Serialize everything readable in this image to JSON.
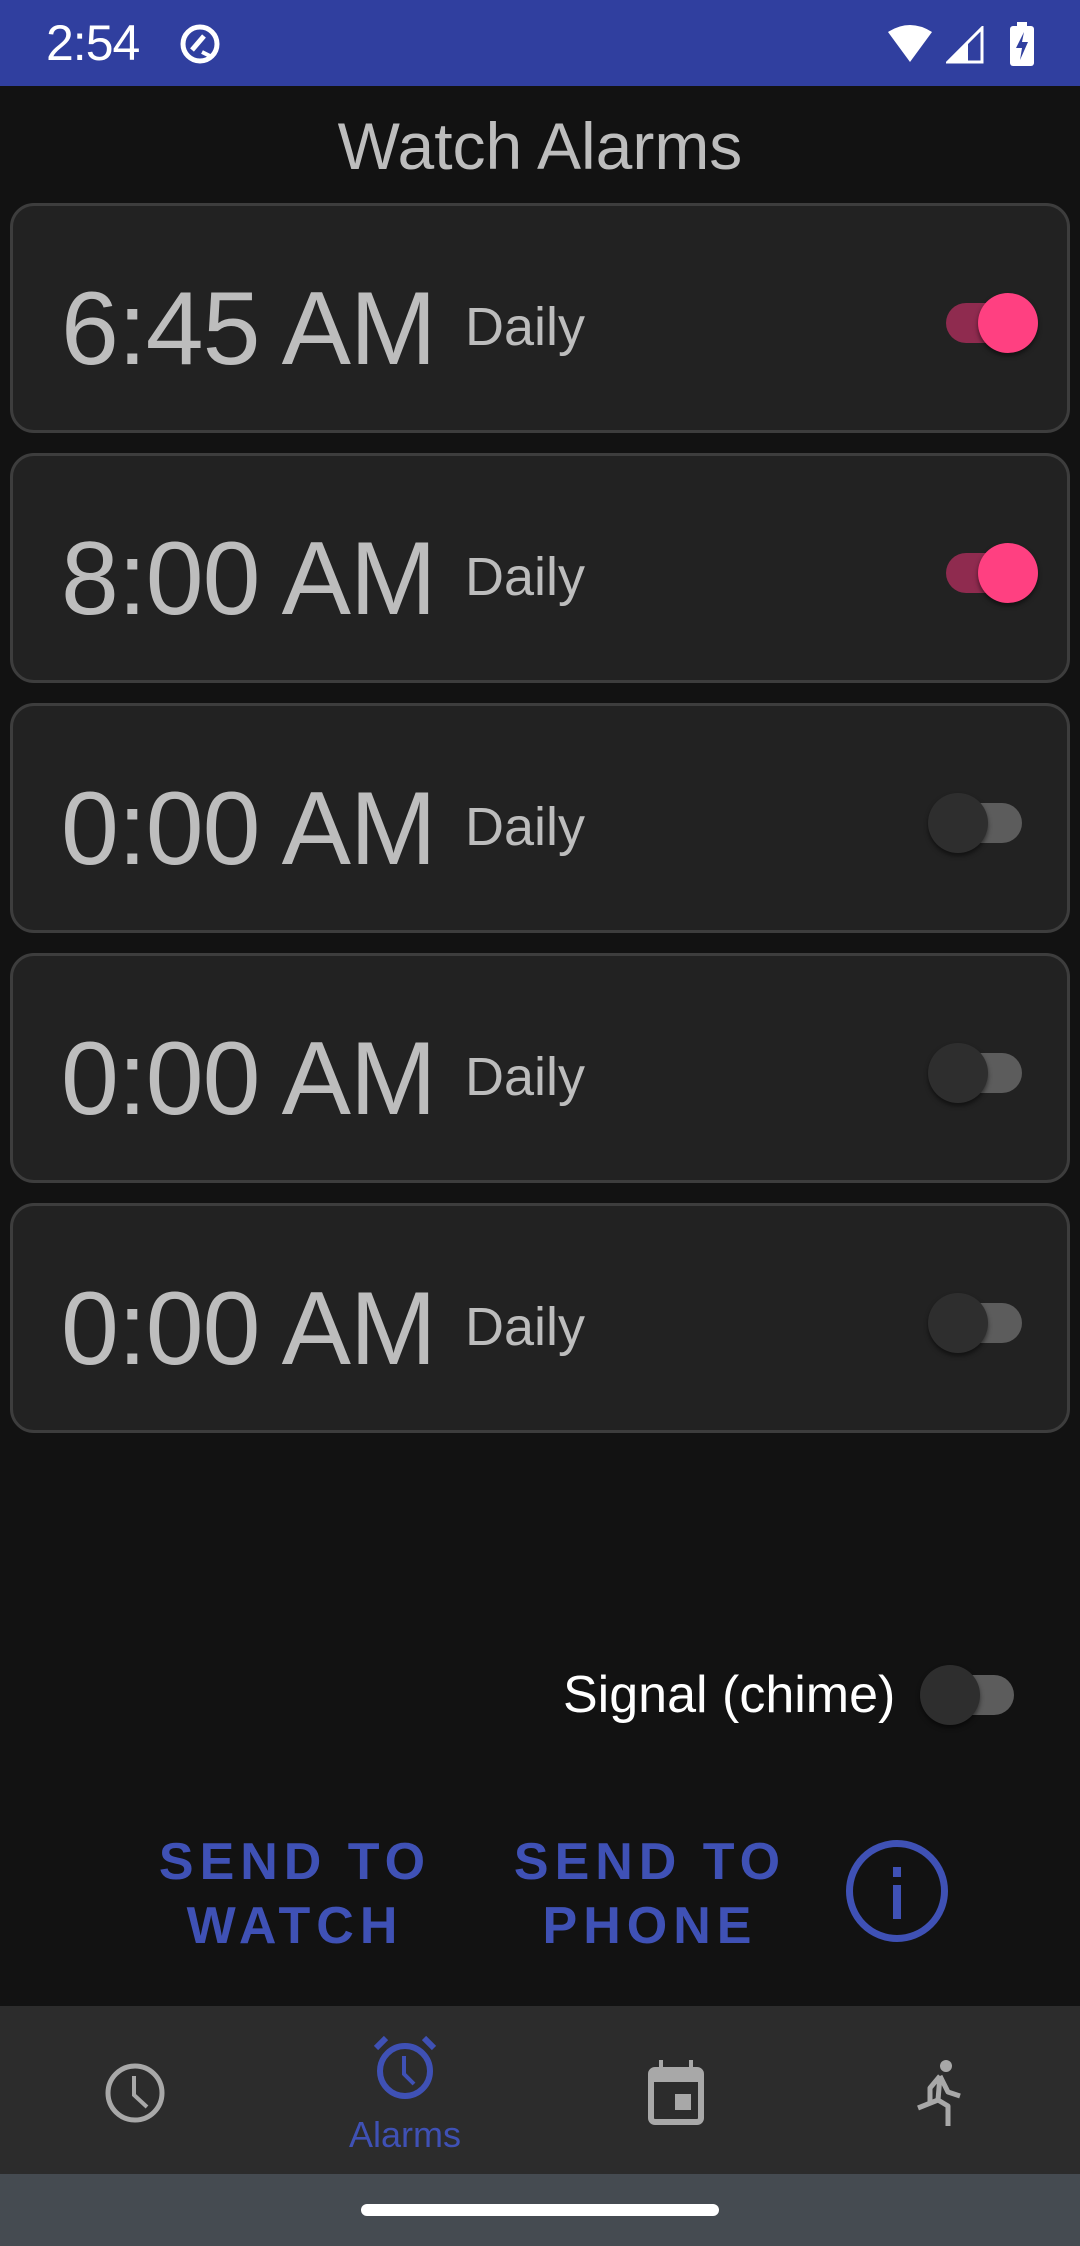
{
  "status_bar": {
    "time": "2:54",
    "icons": [
      "data-saver-icon",
      "wifi-icon",
      "cell-signal-icon",
      "battery-charging-icon"
    ],
    "color": "#303f9f"
  },
  "title": "Watch Alarms",
  "alarms": [
    {
      "time": "6:45 AM",
      "repeat": "Daily",
      "enabled": true
    },
    {
      "time": "8:00 AM",
      "repeat": "Daily",
      "enabled": true
    },
    {
      "time": "0:00 AM",
      "repeat": "Daily",
      "enabled": false
    },
    {
      "time": "0:00 AM",
      "repeat": "Daily",
      "enabled": false
    },
    {
      "time": "0:00 AM",
      "repeat": "Daily",
      "enabled": false
    }
  ],
  "signal": {
    "label": "Signal (chime)",
    "enabled": false
  },
  "actions": {
    "send_to_watch_line1": "SEND TO",
    "send_to_watch_line2": "WATCH",
    "send_to_phone_line1": "SEND TO",
    "send_to_phone_line2": "PHONE",
    "info_icon": "info-icon"
  },
  "bottom_nav": {
    "items": [
      {
        "icon": "clock-icon",
        "label": "",
        "active": false
      },
      {
        "icon": "alarm-icon",
        "label": "Alarms",
        "active": true
      },
      {
        "icon": "calendar-icon",
        "label": "",
        "active": false
      },
      {
        "icon": "running-icon",
        "label": "",
        "active": false
      }
    ]
  },
  "colors": {
    "accent": "#3f51b5",
    "switch_on": "#ff4081",
    "background": "#121212",
    "card": "#222222"
  }
}
